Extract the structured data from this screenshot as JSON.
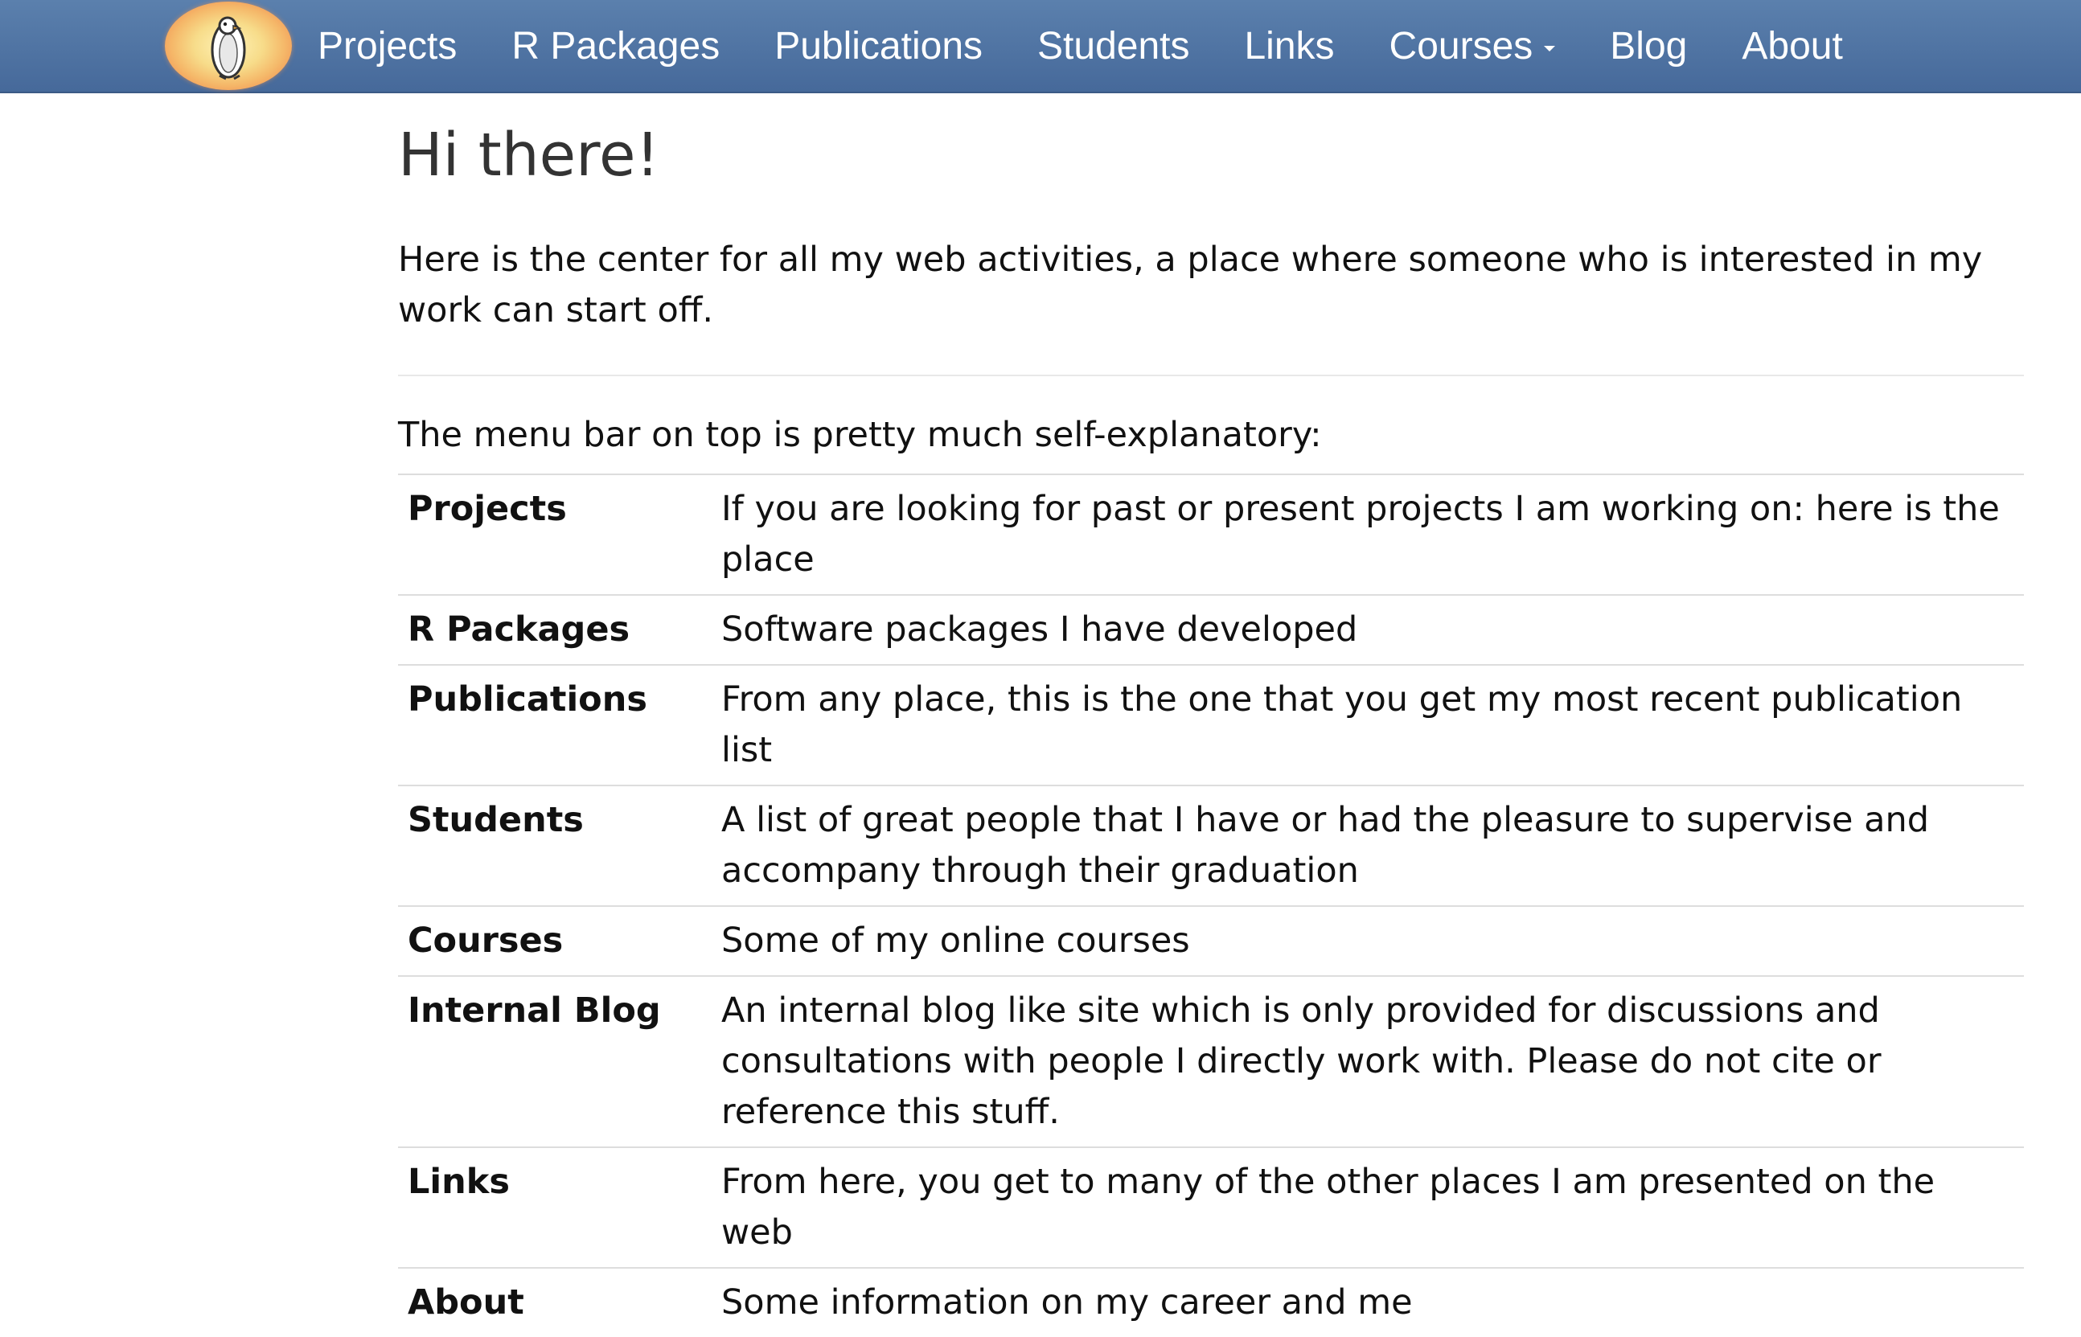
{
  "navbar": {
    "logo_icon": "penguin-logo-icon",
    "items": [
      {
        "label": "Projects"
      },
      {
        "label": "R Packages"
      },
      {
        "label": "Publications"
      },
      {
        "label": "Students"
      },
      {
        "label": "Links"
      },
      {
        "label": "Courses",
        "dropdown": true
      },
      {
        "label": "Blog"
      },
      {
        "label": "About"
      }
    ],
    "colors": {
      "top": "#5b80ad",
      "bottom": "#46699a",
      "text": "#ffffff"
    }
  },
  "main": {
    "title": "Hi there!",
    "intro": "Here is the center for all my web activities, a place where someone who is interested in my work can start off.",
    "menu_note": "The menu bar on top is pretty much self-explanatory:",
    "table": [
      {
        "term": "Projects",
        "desc": "If you are looking for past or present projects I am working on: here is the place"
      },
      {
        "term": "R Packages",
        "desc": "Software packages I have developed"
      },
      {
        "term": "Publications",
        "desc": "From any place, this is the one that you get my most recent publication list"
      },
      {
        "term": "Students",
        "desc": "A list of great people that I have or had the pleasure to supervise and accompany through their graduation"
      },
      {
        "term": "Courses",
        "desc": "Some of my online courses"
      },
      {
        "term": "Internal Blog",
        "desc": "An internal blog like site which is only provided for discussions and consultations with people I directly work with. Please do not cite or reference this stuff."
      },
      {
        "term": "Links",
        "desc": "From here, you get to many of the other places I am presented on the web"
      },
      {
        "term": "About",
        "desc": "Some information on my career and me"
      }
    ]
  }
}
